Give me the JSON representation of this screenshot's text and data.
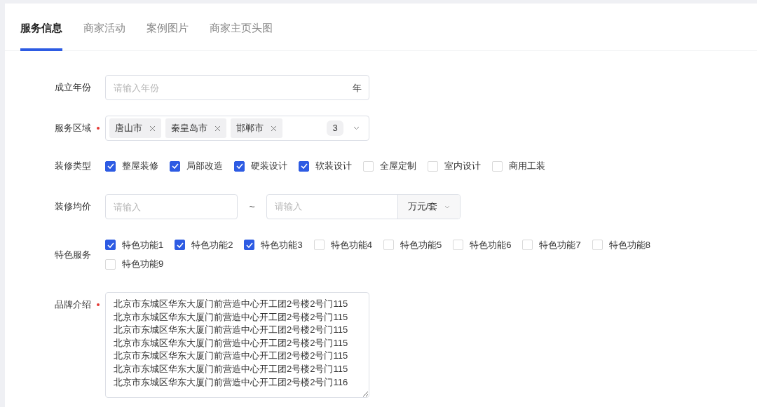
{
  "tabs": [
    {
      "label": "服务信息",
      "selected": true
    },
    {
      "label": "商家活动",
      "selected": false
    },
    {
      "label": "案例图片",
      "selected": false
    },
    {
      "label": "商家主页头图",
      "selected": false
    }
  ],
  "form": {
    "founded": {
      "label": "成立年份",
      "placeholder": "请输入年份",
      "suffix": "年",
      "required": false
    },
    "area": {
      "label": "服务区域",
      "required": true,
      "tags": [
        "唐山市",
        "秦皇岛市",
        "邯郸市"
      ],
      "count": "3"
    },
    "types": {
      "label": "装修类型",
      "required": false,
      "options": [
        {
          "label": "整屋装修",
          "checked": true
        },
        {
          "label": "局部改造",
          "checked": true
        },
        {
          "label": "硬装设计",
          "checked": true
        },
        {
          "label": "软装设计",
          "checked": true
        },
        {
          "label": "全屋定制",
          "checked": false
        },
        {
          "label": "室内设计",
          "checked": false
        },
        {
          "label": "商用工装",
          "checked": false
        }
      ]
    },
    "price": {
      "label": "装修均价",
      "required": false,
      "min_placeholder": "请输入",
      "separator": "~",
      "max_placeholder": "请输入",
      "unit": "万元/套"
    },
    "features": {
      "label": "特色服务",
      "required": false,
      "options": [
        {
          "label": "特色功能1",
          "checked": true
        },
        {
          "label": "特色功能2",
          "checked": true
        },
        {
          "label": "特色功能3",
          "checked": true
        },
        {
          "label": "特色功能4",
          "checked": false
        },
        {
          "label": "特色功能5",
          "checked": false
        },
        {
          "label": "特色功能6",
          "checked": false
        },
        {
          "label": "特色功能7",
          "checked": false
        },
        {
          "label": "特色功能8",
          "checked": false
        },
        {
          "label": "特色功能9",
          "checked": false
        }
      ]
    },
    "brand": {
      "label": "品牌介绍",
      "required": true,
      "value": "北京市东城区华东大厦门前营造中心开工团2号楼2号门115\n北京市东城区华东大厦门前营造中心开工团2号楼2号门115\n北京市东城区华东大厦门前营造中心开工团2号楼2号门115\n北京市东城区华东大厦门前营造中心开工团2号楼2号门115\n北京市东城区华东大厦门前营造中心开工团2号楼2号门115\n北京市东城区华东大厦门前营造中心开工团2号楼2号门115\n北京市东城区华东大厦门前营造中心开工团2号楼2号门116"
    }
  }
}
